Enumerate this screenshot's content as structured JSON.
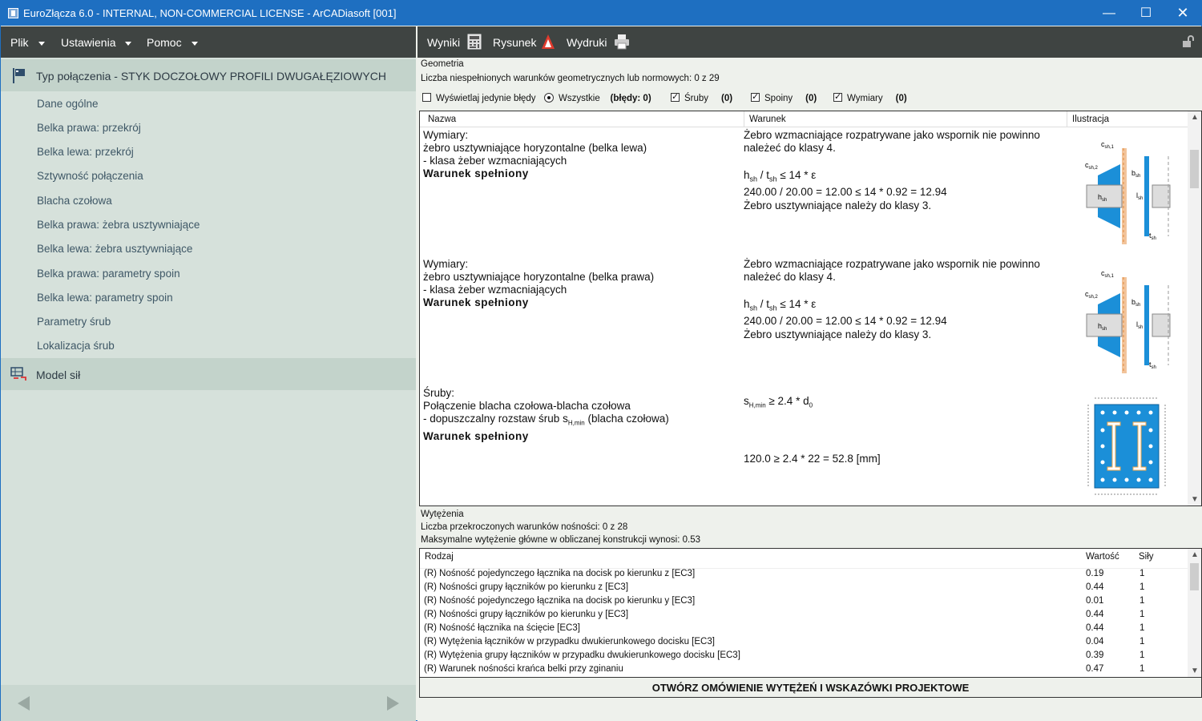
{
  "window": {
    "title": "EuroZłącza 6.0 - INTERNAL, NON-COMMERCIAL LICENSE - ArCADiasoft [001]"
  },
  "menubar": {
    "items": [
      "Plik",
      "Ustawienia",
      "Pomoc"
    ]
  },
  "toolbar": {
    "wyniki": "Wyniki",
    "rysunek": "Rysunek",
    "wydruki": "Wydruki"
  },
  "sidebar": {
    "section1": "Typ połączenia - STYK DOCZOŁOWY PROFILI DWUGAŁĘZIOWYCH",
    "items": [
      "Dane ogólne",
      "Belka prawa: przekrój",
      "Belka lewa: przekrój",
      "Sztywność połączenia",
      "Blacha czołowa",
      "Belka prawa: żebra usztywniające",
      "Belka lewa: żebra usztywniające",
      "Belka prawa: parametry spoin",
      "Belka lewa: parametry spoin",
      "Parametry śrub",
      "Lokalizacja śrub"
    ],
    "section2": "Model sił"
  },
  "geometry": {
    "heading": "Geometria",
    "summary": "Liczba niespełnionych warunków geometrycznych lub normowych: 0 z 29",
    "filters": {
      "only_errors": "Wyświetlaj jedynie błędy",
      "all": "Wszystkie",
      "all_count": "(błędy: 0)",
      "bolts": "Śruby",
      "bolts_count": "(0)",
      "welds": "Spoiny",
      "welds_count": "(0)",
      "dims": "Wymiary",
      "dims_count": "(0)"
    },
    "columns": [
      "Nazwa",
      "Warunek",
      "Ilustracja"
    ],
    "rows": [
      {
        "name": [
          "Wymiary:",
          "żebro usztywniające horyzontalne (belka lewa)",
          "- klasa żeber wzmacniających"
        ],
        "status": "Warunek spełniony",
        "cond1": "Żebro wzmacniające rozpatrywane jako wspornik nie powinno",
        "cond2": "należeć do klasy 4.",
        "formula_h": "h",
        "formula_sub1": "sh",
        "formula_mid": " / t",
        "formula_sub2": "sh",
        "formula_rest": " ≤ 14 * ε",
        "calc": "240.00 / 20.00 = 12.00 ≤ 14 * 0.92 = 12.94",
        "result": "Żebro usztywniające należy do klasy 3."
      },
      {
        "name": [
          "Wymiary:",
          "żebro usztywniające horyzontalne (belka prawa)",
          "- klasa żeber wzmacniających"
        ],
        "status": "Warunek spełniony",
        "cond1": "Żebro wzmacniające rozpatrywane jako wspornik nie powinno",
        "cond2": "należeć do klasy 4.",
        "formula_h": "h",
        "formula_sub1": "sh",
        "formula_mid": " / t",
        "formula_sub2": "sh",
        "formula_rest": " ≤ 14 * ε",
        "calc": "240.00 / 20.00 = 12.00 ≤ 14 * 0.92 = 12.94",
        "result": "Żebro usztywniające należy do klasy 3."
      },
      {
        "name": [
          "Śruby:",
          "Połączenie blacha czołowa-blacha czołowa"
        ],
        "name3": "- dopuszczalny rozstaw śrub s",
        "name3_sub": "H,min",
        "name3_end": " (blacha czołowa)",
        "status": "Warunek spełniony",
        "formula_s": "s",
        "formula_sub": "H,min",
        "formula_rest": " ≥ 2.4 * d",
        "formula_sub2": "0",
        "calc": "120.0 ≥ 2.4 * 22 = 52.8 [mm]"
      }
    ],
    "illus_labels": {
      "c1": "c",
      "c1s": "sh,1",
      "c2": "c",
      "c2s": "sh,2",
      "b": "b",
      "bs": "sh",
      "h": "h",
      "hs": "sh",
      "l": "l",
      "ls": "sh",
      "t": "t",
      "ts": "sh"
    }
  },
  "wytezenia": {
    "heading": "Wytężenia",
    "summary1": "Liczba przekroczonych warunków nośności: 0 z 28",
    "summary2": "Maksymalne wytężenie główne w obliczanej konstrukcji wynosi: 0.53",
    "columns": [
      "Rodzaj",
      "Wartość",
      "Siły"
    ],
    "rows": [
      {
        "rodzaj": "(R) Nośność pojedynczego łącznika na docisk po kierunku z [EC3]",
        "wartosc": "0.19",
        "sily": "1"
      },
      {
        "rodzaj": "(R) Nośności grupy łączników po kierunku z [EC3]",
        "wartosc": "0.44",
        "sily": "1"
      },
      {
        "rodzaj": "(R) Nośność pojedynczego łącznika na docisk po kierunku y [EC3]",
        "wartosc": "0.01",
        "sily": "1"
      },
      {
        "rodzaj": "(R) Nośności grupy łączników po kierunku y [EC3]",
        "wartosc": "0.44",
        "sily": "1"
      },
      {
        "rodzaj": "(R) Nośność łącznika na ścięcie [EC3]",
        "wartosc": "0.44",
        "sily": "1"
      },
      {
        "rodzaj": "(R) Wytężenia łączników w przypadku dwukierunkowego docisku [EC3]",
        "wartosc": "0.04",
        "sily": "1"
      },
      {
        "rodzaj": "(R) Wytężenia grupy łączników w przypadku dwukierunkowego docisku [EC3]",
        "wartosc": "0.39",
        "sily": "1"
      },
      {
        "rodzaj": "(R) Warunek nośności krańca belki przy zginaniu",
        "wartosc": "0.47",
        "sily": "1"
      }
    ],
    "open_button": "OTWÓRZ OMÓWIENIE WYTĘŻEŃ I WSKAZÓWKI PROJEKTOWE"
  },
  "colors": {
    "titlebar": "#1e6fc1",
    "toolbar": "#3f4442",
    "sidebar": "#d6e1db",
    "steel_blue": "#1b8fd8"
  }
}
